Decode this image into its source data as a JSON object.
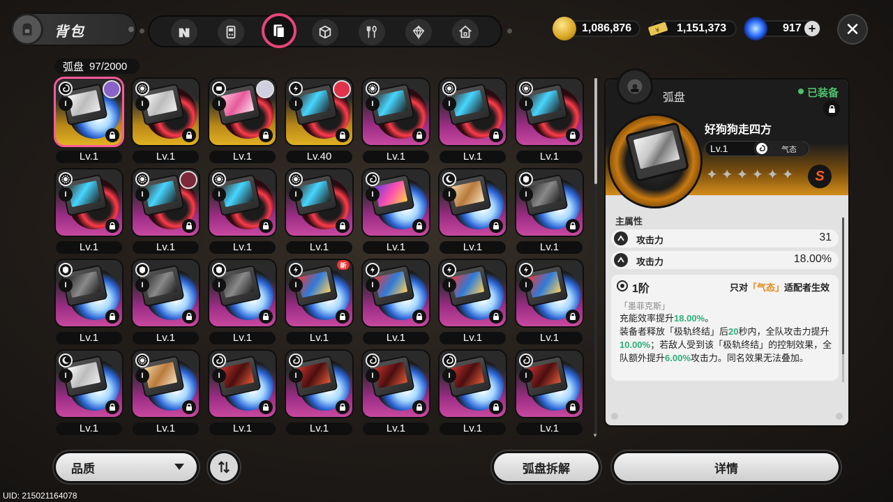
{
  "header": {
    "title": "背包",
    "tabs": [
      {
        "name": "agent-tab",
        "icon": "n-logo-icon"
      },
      {
        "name": "device-tab",
        "icon": "gameboy-icon"
      },
      {
        "name": "disc-tab",
        "icon": "disc-case-icon",
        "active": true
      },
      {
        "name": "box-tab",
        "icon": "cube-icon"
      },
      {
        "name": "food-tab",
        "icon": "fork-spoon-icon"
      },
      {
        "name": "material-tab",
        "icon": "gem-icon"
      },
      {
        "name": "home-tab",
        "icon": "house-icon"
      }
    ],
    "currencies": [
      {
        "icon": "gold-coin-icon",
        "value": "1,086,876"
      },
      {
        "icon": "ticket-icon",
        "value": "1,151,373"
      },
      {
        "icon": "blue-orb-icon",
        "value": "917"
      }
    ]
  },
  "inventory": {
    "label": "弧盘",
    "count": "97/2000",
    "items": [
      {
        "level": "Lv.1",
        "rarity": "gold",
        "attr": "swirl",
        "art": "white",
        "avatar": "purple",
        "selected": true
      },
      {
        "level": "Lv.1",
        "rarity": "gold",
        "attr": "gear",
        "art": "white",
        "avatar": ""
      },
      {
        "level": "Lv.1",
        "rarity": "gold",
        "attr": "fist",
        "art": "pink",
        "avatar": "silver"
      },
      {
        "level": "Lv.40",
        "rarity": "gold",
        "attr": "bolt",
        "art": "cyan",
        "avatar": "red"
      },
      {
        "level": "Lv.1",
        "rarity": "pink",
        "attr": "gear",
        "art": "cyan",
        "avatar": ""
      },
      {
        "level": "Lv.1",
        "rarity": "pink",
        "attr": "gear",
        "art": "cyan",
        "avatar": ""
      },
      {
        "level": "Lv.1",
        "rarity": "pink",
        "attr": "gear",
        "art": "cyan",
        "avatar": ""
      },
      {
        "level": "Lv.1",
        "rarity": "pink",
        "attr": "gear",
        "art": "cyan",
        "avatar": ""
      },
      {
        "level": "Lv.1",
        "rarity": "pink",
        "attr": "gear",
        "art": "cyan",
        "avatar": "dark"
      },
      {
        "level": "Lv.1",
        "rarity": "pink",
        "attr": "gear",
        "art": "cyan",
        "avatar": ""
      },
      {
        "level": "Lv.1",
        "rarity": "pink",
        "attr": "gear",
        "art": "cyan",
        "avatar": ""
      },
      {
        "level": "Lv.1",
        "rarity": "pink",
        "attr": "swirl",
        "art": "purple",
        "avatar": ""
      },
      {
        "level": "Lv.1",
        "rarity": "pink",
        "attr": "moon",
        "art": "tan",
        "avatar": ""
      },
      {
        "level": "Lv.1",
        "rarity": "pink",
        "attr": "shield",
        "art": "gray",
        "avatar": ""
      },
      {
        "level": "Lv.1",
        "rarity": "pink",
        "attr": "shield",
        "art": "gray",
        "avatar": ""
      },
      {
        "level": "Lv.1",
        "rarity": "pink",
        "attr": "shield",
        "art": "gray",
        "avatar": ""
      },
      {
        "level": "Lv.1",
        "rarity": "pink",
        "attr": "shield",
        "art": "gray",
        "avatar": ""
      },
      {
        "level": "Lv.1",
        "rarity": "pink",
        "attr": "bolt",
        "art": "red",
        "avatar": "",
        "new": "新"
      },
      {
        "level": "Lv.1",
        "rarity": "pink",
        "attr": "bolt",
        "art": "red",
        "avatar": ""
      },
      {
        "level": "Lv.1",
        "rarity": "pink",
        "attr": "bolt",
        "art": "red",
        "avatar": ""
      },
      {
        "level": "Lv.1",
        "rarity": "pink",
        "attr": "bolt",
        "art": "red",
        "avatar": ""
      },
      {
        "level": "Lv.1",
        "rarity": "pink",
        "attr": "moon",
        "art": "white",
        "avatar": ""
      },
      {
        "level": "Lv.1",
        "rarity": "pink",
        "attr": "gear",
        "art": "tan",
        "avatar": ""
      },
      {
        "level": "Lv.1",
        "rarity": "pink",
        "attr": "swirl",
        "art": "darkred",
        "avatar": ""
      },
      {
        "level": "Lv.1",
        "rarity": "pink",
        "attr": "swirl",
        "art": "darkred",
        "avatar": ""
      },
      {
        "level": "Lv.1",
        "rarity": "pink",
        "attr": "swirl",
        "art": "darkred",
        "avatar": ""
      },
      {
        "level": "Lv.1",
        "rarity": "pink",
        "attr": "swirl",
        "art": "darkred",
        "avatar": ""
      },
      {
        "level": "Lv.1",
        "rarity": "pink",
        "attr": "swirl",
        "art": "darkred",
        "avatar": ""
      }
    ]
  },
  "detail": {
    "label": "弧盘",
    "equipped": "已装备",
    "name": "好狗狗走四方",
    "level": "Lv.1",
    "attribute": "气态",
    "stars": "✦✦✦✦✦✦",
    "rank_badge": "S",
    "main_attr_title": "主属性",
    "stats": [
      {
        "name": "攻击力",
        "value": "31"
      },
      {
        "name": "攻击力",
        "value": "18.00%"
      }
    ],
    "tier": "1阶",
    "only_for_prefix": "只对",
    "only_for_attr": "「气态」",
    "only_for_suffix": "适配者生效",
    "effect_name": "「墨菲克斯」",
    "effect_lines": {
      "p1a": "充能效率提升",
      "p1b": "18.00%",
      "p1c": "。",
      "p2a": "装备者释放「极轨终结」后",
      "p2b": "20",
      "p2c": "秒内，全队攻击力提升",
      "p2d": "10.00%",
      "p2e": "；若敌人受到该「极轨终结」的控制效果，全队额外提升",
      "p2f": "6.00%",
      "p2g": "攻击力。同名效果无法叠加。"
    }
  },
  "footer": {
    "quality_label": "品质",
    "dismantle_label": "弧盘拆解",
    "detail_label": "详情",
    "uid": "UID: 215021164078"
  },
  "colors": {
    "accent_pink": "#e8457a",
    "rarity_gold": "#e1b024",
    "rarity_pink": "#c8489f",
    "highlight_green": "#2bae7a",
    "highlight_orange": "#e48a17"
  }
}
